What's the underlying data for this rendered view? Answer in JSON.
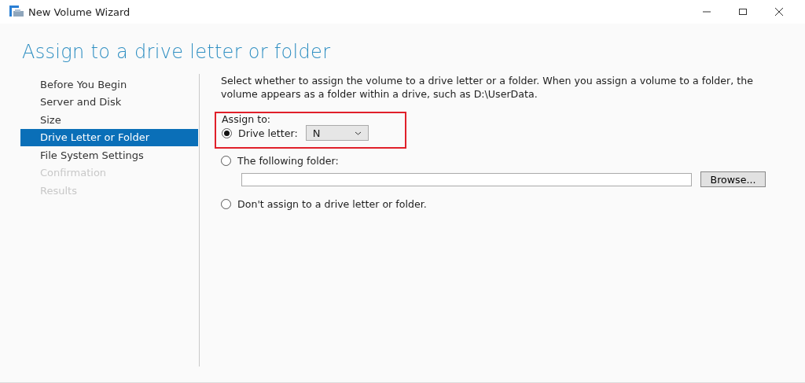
{
  "window": {
    "title": "New Volume Wizard"
  },
  "heading": "Assign to a drive letter or folder",
  "steps": [
    {
      "label": "Before You Begin",
      "selected": false,
      "disabled": false
    },
    {
      "label": "Server and Disk",
      "selected": false,
      "disabled": false
    },
    {
      "label": "Size",
      "selected": false,
      "disabled": false
    },
    {
      "label": "Drive Letter or Folder",
      "selected": true,
      "disabled": false
    },
    {
      "label": "File System Settings",
      "selected": false,
      "disabled": false
    },
    {
      "label": "Confirmation",
      "selected": false,
      "disabled": true
    },
    {
      "label": "Results",
      "selected": false,
      "disabled": true
    }
  ],
  "description": "Select whether to assign the volume to a drive letter or a folder. When you assign a volume to a folder, the volume appears as a folder within a drive, such as D:\\UserData.",
  "assign_label": "Assign to:",
  "options": [
    {
      "kind": "drive",
      "label": "Drive letter:",
      "selected": true,
      "value": "N"
    },
    {
      "kind": "folder",
      "label": "The following folder:",
      "selected": false,
      "button": "Browse..."
    },
    {
      "kind": "none",
      "label": "Don't assign to a drive letter or folder.",
      "selected": false
    }
  ]
}
